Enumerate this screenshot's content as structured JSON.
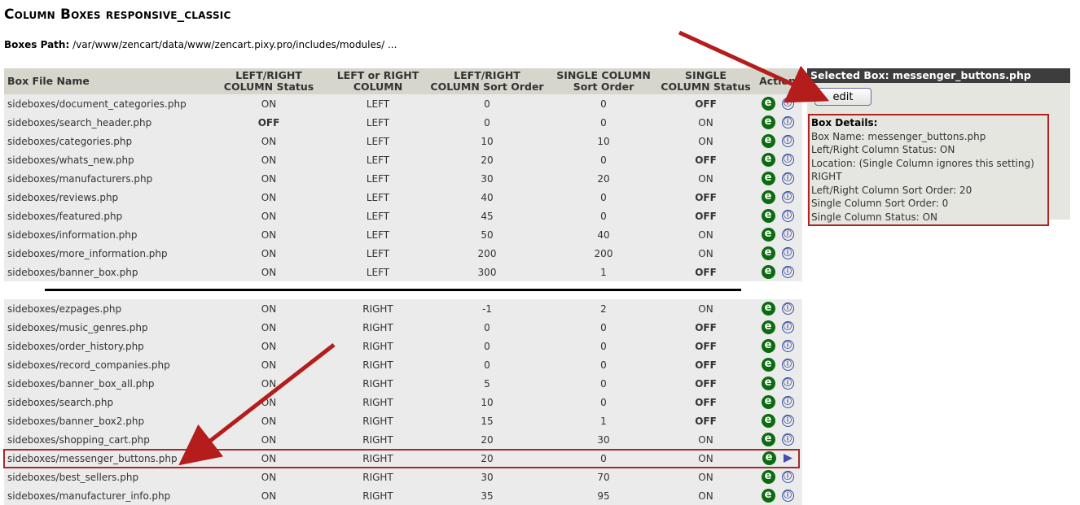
{
  "page_title": "Column Boxes responsive_classic",
  "boxes_path_label": "Boxes Path:",
  "boxes_path_value": "/var/www/zencart/data/www/zencart.pixy.pro/includes/modules/ ...",
  "headers": {
    "name": "Box File Name",
    "lr_status": "LEFT/RIGHT COLUMN Status",
    "lr_col": "LEFT or RIGHT COLUMN",
    "lr_sort": "LEFT/RIGHT COLUMN Sort Order",
    "single_sort": "SINGLE COLUMN Sort Order",
    "single_status": "SINGLE COLUMN Status",
    "action": "Action"
  },
  "left_rows": [
    {
      "name": "sideboxes/document_categories.php",
      "status": "ON",
      "col": "LEFT",
      "lr": "0",
      "ss": "0",
      "sst": "OFF"
    },
    {
      "name": "sideboxes/search_header.php",
      "status": "OFF",
      "col": "LEFT",
      "lr": "0",
      "ss": "0",
      "sst": "ON"
    },
    {
      "name": "sideboxes/categories.php",
      "status": "ON",
      "col": "LEFT",
      "lr": "10",
      "ss": "10",
      "sst": "ON"
    },
    {
      "name": "sideboxes/whats_new.php",
      "status": "ON",
      "col": "LEFT",
      "lr": "20",
      "ss": "0",
      "sst": "OFF"
    },
    {
      "name": "sideboxes/manufacturers.php",
      "status": "ON",
      "col": "LEFT",
      "lr": "30",
      "ss": "20",
      "sst": "ON"
    },
    {
      "name": "sideboxes/reviews.php",
      "status": "ON",
      "col": "LEFT",
      "lr": "40",
      "ss": "0",
      "sst": "OFF"
    },
    {
      "name": "sideboxes/featured.php",
      "status": "ON",
      "col": "LEFT",
      "lr": "45",
      "ss": "0",
      "sst": "OFF"
    },
    {
      "name": "sideboxes/information.php",
      "status": "ON",
      "col": "LEFT",
      "lr": "50",
      "ss": "40",
      "sst": "ON"
    },
    {
      "name": "sideboxes/more_information.php",
      "status": "ON",
      "col": "LEFT",
      "lr": "200",
      "ss": "200",
      "sst": "ON"
    },
    {
      "name": "sideboxes/banner_box.php",
      "status": "ON",
      "col": "LEFT",
      "lr": "300",
      "ss": "1",
      "sst": "OFF"
    }
  ],
  "right_rows": [
    {
      "name": "sideboxes/ezpages.php",
      "status": "ON",
      "col": "RIGHT",
      "lr": "-1",
      "ss": "2",
      "sst": "ON"
    },
    {
      "name": "sideboxes/music_genres.php",
      "status": "ON",
      "col": "RIGHT",
      "lr": "0",
      "ss": "0",
      "sst": "OFF"
    },
    {
      "name": "sideboxes/order_history.php",
      "status": "ON",
      "col": "RIGHT",
      "lr": "0",
      "ss": "0",
      "sst": "OFF"
    },
    {
      "name": "sideboxes/record_companies.php",
      "status": "ON",
      "col": "RIGHT",
      "lr": "0",
      "ss": "0",
      "sst": "OFF"
    },
    {
      "name": "sideboxes/banner_box_all.php",
      "status": "ON",
      "col": "RIGHT",
      "lr": "5",
      "ss": "0",
      "sst": "OFF"
    },
    {
      "name": "sideboxes/search.php",
      "status": "ON",
      "col": "RIGHT",
      "lr": "10",
      "ss": "0",
      "sst": "OFF"
    },
    {
      "name": "sideboxes/banner_box2.php",
      "status": "ON",
      "col": "RIGHT",
      "lr": "15",
      "ss": "1",
      "sst": "OFF"
    },
    {
      "name": "sideboxes/shopping_cart.php",
      "status": "ON",
      "col": "RIGHT",
      "lr": "20",
      "ss": "30",
      "sst": "ON"
    },
    {
      "name": "sideboxes/messenger_buttons.php",
      "status": "ON",
      "col": "RIGHT",
      "lr": "20",
      "ss": "0",
      "sst": "ON",
      "selected": true
    },
    {
      "name": "sideboxes/best_sellers.php",
      "status": "ON",
      "col": "RIGHT",
      "lr": "30",
      "ss": "70",
      "sst": "ON"
    },
    {
      "name": "sideboxes/manufacturer_info.php",
      "status": "ON",
      "col": "RIGHT",
      "lr": "35",
      "ss": "95",
      "sst": "ON"
    }
  ],
  "icons": {
    "edit": "e",
    "info": "ⓘ"
  },
  "side_panel": {
    "title": "Selected Box: messenger_buttons.php",
    "edit_label": "edit",
    "details_title": "Box Details:",
    "details": [
      "Box Name: messenger_buttons.php",
      "Left/Right Column Status: ON",
      "Location: (Single Column ignores this setting)",
      "RIGHT",
      "Left/Right Column Sort Order: 20",
      "Single Column Sort Order: 0",
      "Single Column Status: ON"
    ]
  },
  "colors": {
    "off": "#e00000",
    "edit_icon": "#0c6b10",
    "highlight": "#a52a2a",
    "arrow": "#b51c1c"
  }
}
